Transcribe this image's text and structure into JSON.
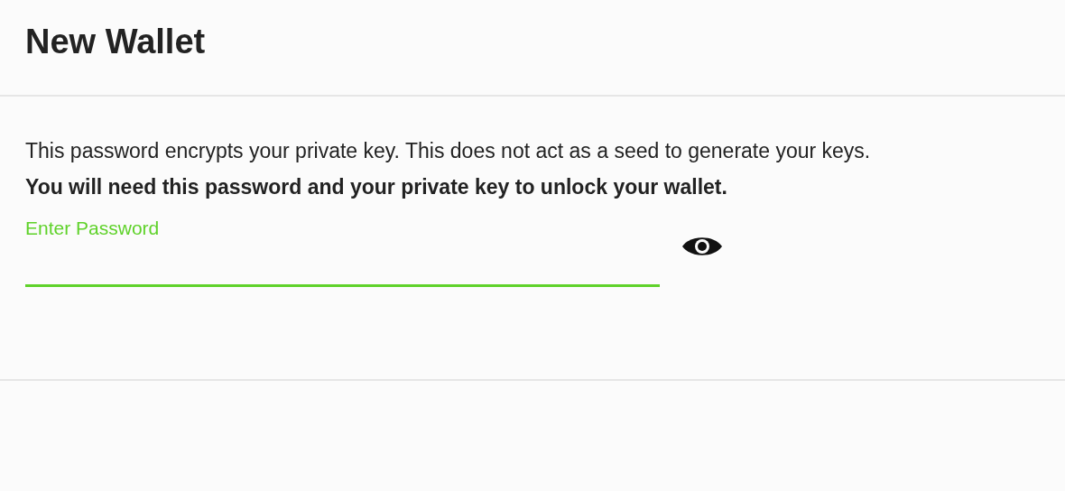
{
  "header": {
    "title": "New Wallet"
  },
  "description": "This password encrypts your private key. This does not act as a seed to generate your keys.",
  "warning": "You will need this password and your private key to unlock your wallet.",
  "password_field": {
    "label": "Enter Password",
    "focused": true
  }
}
